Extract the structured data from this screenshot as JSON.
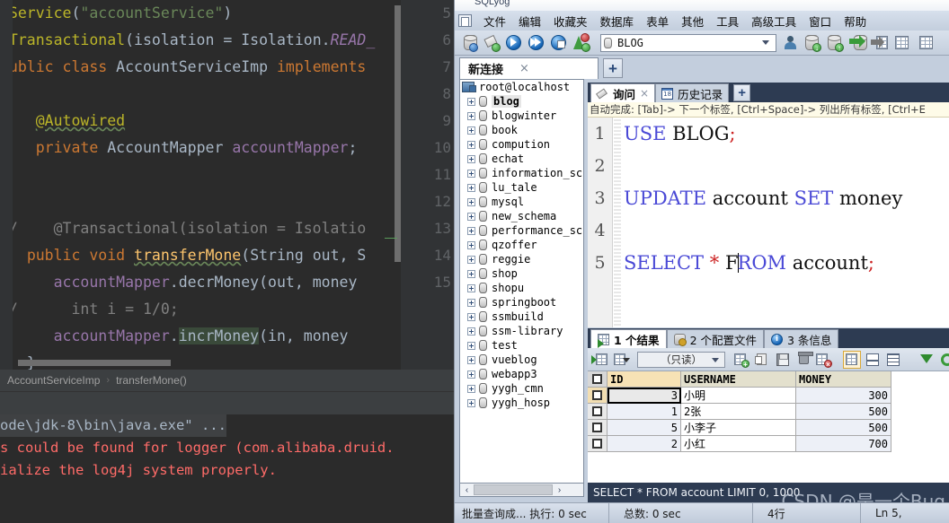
{
  "ide": {
    "code_lines": [
      {
        "n": 5,
        "tokens": [
          {
            "t": "@Service",
            "c": "t-ann"
          },
          {
            "t": "(",
            "c": "t-punc"
          },
          {
            "t": "\"accountService\"",
            "c": "t-str"
          },
          {
            "t": ")",
            "c": "t-punc"
          }
        ]
      },
      {
        "n": 6,
        "tokens": [
          {
            "t": "@Transactional",
            "c": "t-ann"
          },
          {
            "t": "(",
            "c": "t-punc"
          },
          {
            "t": "isolation",
            "c": "t-cls"
          },
          {
            "t": " = ",
            "c": "t-punc"
          },
          {
            "t": "Isolation",
            "c": "t-cls"
          },
          {
            "t": ".",
            "c": "t-punc"
          },
          {
            "t": "READ_",
            "c": "t-static"
          }
        ]
      },
      {
        "n": 7,
        "tokens": [
          {
            "t": "public ",
            "c": "t-kw"
          },
          {
            "t": "class ",
            "c": "t-kw"
          },
          {
            "t": "AccountServiceImp ",
            "c": "t-cls"
          },
          {
            "t": "implements",
            "c": "t-kw"
          }
        ]
      },
      {
        "n": 8,
        "tokens": []
      },
      {
        "n": 9,
        "tokens": [
          {
            "t": "    ",
            "c": "t-punc"
          },
          {
            "t": "@Autowired",
            "c": "t-ann wavy"
          }
        ]
      },
      {
        "n": 10,
        "tokens": [
          {
            "t": "    ",
            "c": "t-punc"
          },
          {
            "t": "private ",
            "c": "t-kw"
          },
          {
            "t": "AccountMapper ",
            "c": "t-cls"
          },
          {
            "t": "accountMapper",
            "c": "t-fld"
          },
          {
            "t": ";",
            "c": "t-punc"
          }
        ]
      },
      {
        "n": 11,
        "tokens": []
      },
      {
        "n": 12,
        "tokens": []
      },
      {
        "n": 13,
        "tokens": [
          {
            "t": "//    @Transactional(isolation = Isolatio",
            "c": "t-com"
          }
        ]
      },
      {
        "n": 14,
        "tokens": [
          {
            "t": "   ",
            "c": "t-punc"
          },
          {
            "t": "public ",
            "c": "t-kw"
          },
          {
            "t": "void ",
            "c": "t-kw"
          },
          {
            "t": "transferMone",
            "c": "t-meth wavy"
          },
          {
            "t": "(",
            "c": "t-punc"
          },
          {
            "t": "String ",
            "c": "t-cls"
          },
          {
            "t": "out, ",
            "c": "t-param"
          },
          {
            "t": "S",
            "c": "t-cls"
          }
        ]
      },
      {
        "n": 15,
        "tokens": [
          {
            "t": "      ",
            "c": "t-punc"
          },
          {
            "t": "accountMapper",
            "c": "t-fld"
          },
          {
            "t": ".",
            "c": "t-punc"
          },
          {
            "t": "decrMoney",
            "c": "t-cls"
          },
          {
            "t": "(",
            "c": "t-punc"
          },
          {
            "t": "out, ",
            "c": "t-param"
          },
          {
            "t": "money",
            "c": "t-param"
          }
        ]
      },
      {
        "n": "",
        "tokens": [
          {
            "t": "//      int i = ",
            "c": "t-com"
          },
          {
            "t": "1",
            "c": "t-com"
          },
          {
            "t": "/",
            "c": "t-com"
          },
          {
            "t": "0",
            "c": "t-com"
          },
          {
            "t": ";",
            "c": "t-com"
          }
        ]
      },
      {
        "n": "",
        "tokens": [
          {
            "t": "      ",
            "c": "t-punc"
          },
          {
            "t": "accountMapper",
            "c": "t-fld"
          },
          {
            "t": ".",
            "c": "t-punc"
          },
          {
            "t": "incrMoney",
            "c": "t-cls hl-sel"
          },
          {
            "t": "(",
            "c": "t-punc"
          },
          {
            "t": "in, ",
            "c": "t-param"
          },
          {
            "t": "money",
            "c": "t-param"
          }
        ]
      },
      {
        "n": "",
        "tokens": [
          {
            "t": "   }",
            "c": "t-punc"
          }
        ]
      }
    ],
    "line_numbers": [
      5,
      6,
      7,
      8,
      9,
      10,
      11,
      12,
      13,
      14,
      15
    ],
    "breadcrumb": {
      "class_name": "AccountServiceImp",
      "method_name": "transferMone()",
      "separator": "›"
    },
    "console_lines": [
      {
        "text": "ode\\jdk-8\\bin\\java.exe\" ...",
        "style": "con-grey"
      },
      {
        "text": "s could be found for logger (com.alibaba.druid.",
        "style": "con-red"
      },
      {
        "text": "ialize the log4j system properly.",
        "style": "con-red"
      }
    ]
  },
  "sqlyog": {
    "title": "SQLyog",
    "menu": [
      "文件",
      "编辑",
      "收藏夹",
      "数据库",
      "表单",
      "其他",
      "工具",
      "高级工具",
      "窗口",
      "帮助"
    ],
    "toolbar": {
      "db_selector_value": "BLOG",
      "icons": [
        "new-connection-icon",
        "new-object-icon",
        "execute-query-icon",
        "execute-all-icon",
        "execute-explain-icon",
        "refresh-object-browser-icon"
      ],
      "right_icons": [
        "user-manager-icon",
        "import-data-icon",
        "export-data-icon",
        "backup-icon",
        "export-csv-icon",
        "table-data-icon",
        "schema-designer-icon"
      ]
    },
    "connection_tab": {
      "label": "新连接",
      "close": "×",
      "add": "+"
    },
    "tree": {
      "root": "root@localhost",
      "databases": [
        "blog",
        "blogwinter",
        "book",
        "compution",
        "echat",
        "information_sc",
        "lu_tale",
        "mysql",
        "new_schema",
        "performance_sc",
        "qzoffer",
        "reggie",
        "shop",
        "shopu",
        "springboot",
        "ssmbuild",
        "ssm-library",
        "test",
        "vueblog",
        "webapp3",
        "yygh_cmn",
        "yygh_hosp"
      ],
      "selected": "blog"
    },
    "query_tabs": [
      {
        "label": "询问",
        "active": true,
        "icon": "query-pen-icon",
        "close": "×"
      },
      {
        "label": "历史记录",
        "active": false,
        "icon": "history-calendar-icon"
      }
    ],
    "query_add_tab": "+",
    "autocomplete_hint": "自动完成: [Tab]-> 下一个标签, [Ctrl+Space]-> 列出所有标签, [Ctrl+E",
    "sql_lines": [
      {
        "n": 1,
        "parts": [
          {
            "t": "USE",
            "c": "s-kw"
          },
          {
            "t": " BLOG",
            "c": ""
          },
          {
            "t": ";",
            "c": "s-semi"
          }
        ]
      },
      {
        "n": 2,
        "parts": []
      },
      {
        "n": 3,
        "parts": [
          {
            "t": "UPDATE",
            "c": "s-kw"
          },
          {
            "t": " account ",
            "c": ""
          },
          {
            "t": "SET",
            "c": "s-kw"
          },
          {
            "t": " money",
            "c": ""
          }
        ]
      },
      {
        "n": 4,
        "parts": []
      },
      {
        "n": 5,
        "parts": [
          {
            "t": "SELECT",
            "c": "s-kw"
          },
          {
            "t": " ",
            "c": ""
          },
          {
            "t": "*",
            "c": "s-star"
          },
          {
            "t": " F",
            "c": ""
          },
          {
            "t": "__CARET__",
            "c": ""
          },
          {
            "t": "ROM",
            "c": "s-kw"
          },
          {
            "t": " account",
            "c": ""
          },
          {
            "t": ";",
            "c": "s-semi"
          }
        ]
      }
    ],
    "result_tabs": [
      {
        "label": "1 个结果",
        "active": true,
        "icon": "result-grid-icon"
      },
      {
        "label": "2 个配置文件",
        "active": false,
        "icon": "profile-icon"
      },
      {
        "label": "3 条信息",
        "active": false,
        "icon": "info-icon"
      }
    ],
    "result_toolbar": {
      "mode_value": "（只读）",
      "icons": [
        "grid-view-icon",
        "grid-view-dropdown-icon",
        "insert-row-icon",
        "duplicate-row-icon",
        "save-icon",
        "delete-row-icon",
        "cancel-edit-icon",
        "grid-tab-icon",
        "form-tab-icon",
        "text-tab-icon",
        "filter-icon",
        "refresh-icon"
      ]
    },
    "grid": {
      "columns": [
        "ID",
        "USERNAME",
        "MONEY"
      ],
      "rows": [
        {
          "id": "3",
          "username": "小明",
          "money": "300"
        },
        {
          "id": "1",
          "username": "2张",
          "money": "500"
        },
        {
          "id": "5",
          "username": "小李子",
          "money": "500"
        },
        {
          "id": "2",
          "username": "小红",
          "money": "700"
        }
      ]
    },
    "executed_sql": "SELECT * FROM account LIMIT 0, 1000",
    "tree_hscroll": {
      "left": "‹",
      "right": "›"
    },
    "statusbar": {
      "message": "批量查询成... 执行: 0 sec",
      "total": "总数: 0 sec",
      "rows": "4行",
      "cursor": "Ln 5,"
    },
    "watermark": "CSDN @是一个Bug"
  }
}
